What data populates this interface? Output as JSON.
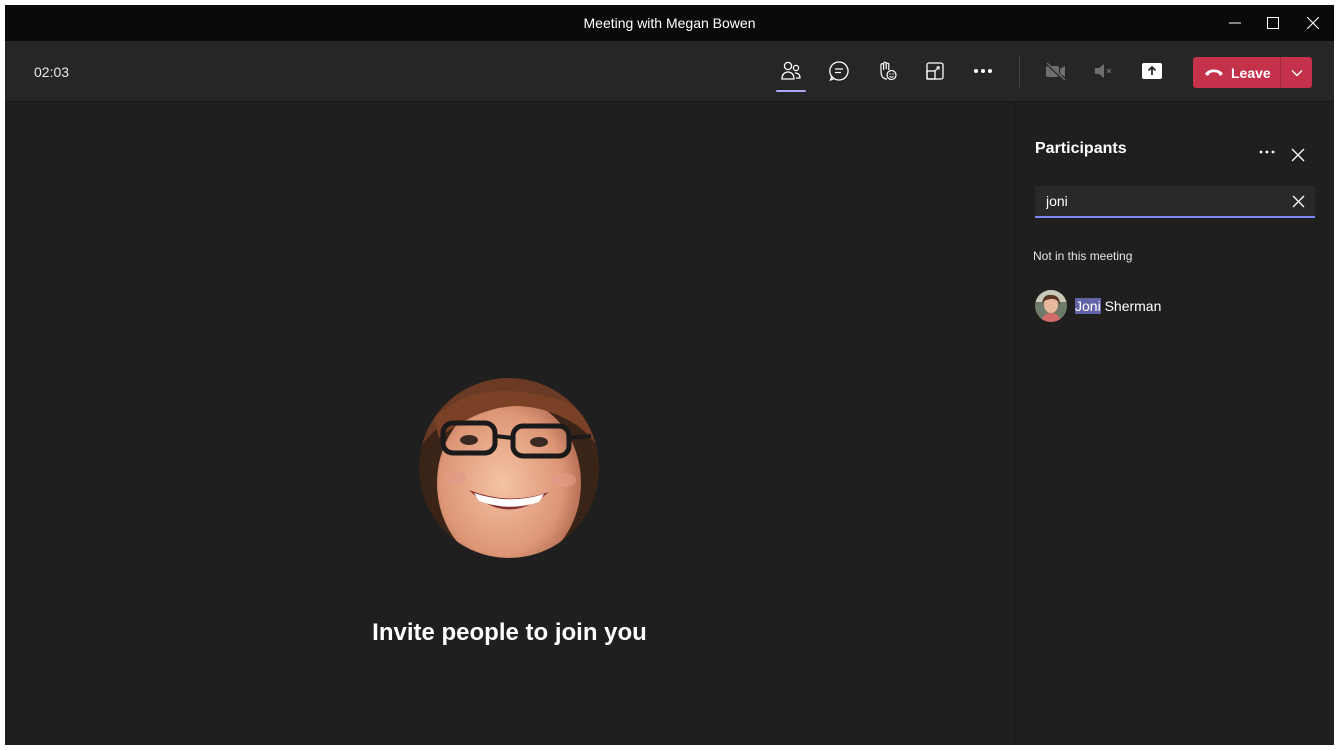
{
  "window": {
    "title": "Meeting with Megan Bowen"
  },
  "toolbar": {
    "timer": "02:03",
    "leave_label": "Leave",
    "buttons": [
      {
        "name": "participants-icon",
        "active": true
      },
      {
        "name": "chat-icon"
      },
      {
        "name": "raise-hand-icon"
      },
      {
        "name": "breakout-icon"
      },
      {
        "name": "more-icon"
      },
      {
        "name": "camera-off-icon"
      },
      {
        "name": "mic-muted-icon"
      },
      {
        "name": "share-icon"
      }
    ]
  },
  "stage": {
    "message": "Invite people to join you"
  },
  "participants_panel": {
    "title": "Participants",
    "search_value": "joni",
    "section_label": "Not in this meeting",
    "people": [
      {
        "highlight": "Joni",
        "rest": " Sherman"
      }
    ]
  },
  "colors": {
    "accent": "#7f85f5",
    "highlight": "#6264a7",
    "leave": "#c4314b",
    "background": "#1f1f1f"
  }
}
